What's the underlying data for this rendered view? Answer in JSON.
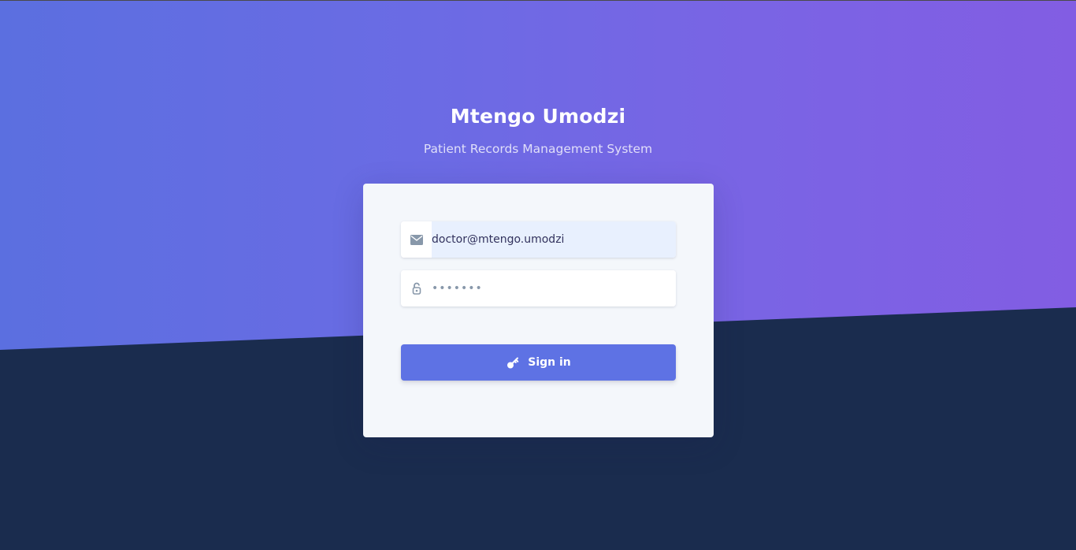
{
  "header": {
    "title": "Mtengo Umodzi",
    "subtitle": "Patient Records Management System"
  },
  "login": {
    "email": {
      "icon": "envelope-icon",
      "value": "doctor@mtengo.umodzi"
    },
    "password": {
      "icon": "unlock-icon",
      "value": "•••••••"
    },
    "submit": {
      "icon": "key-icon",
      "label": "Sign in"
    }
  },
  "colors": {
    "gradient_start": "#5b6fe0",
    "gradient_end": "#825de3",
    "lower_background": "#1a2c4e",
    "card_background": "#f4f7fb",
    "button": "#5e72e4",
    "autofill": "#e8f0fe",
    "icon": "#8898aa"
  }
}
